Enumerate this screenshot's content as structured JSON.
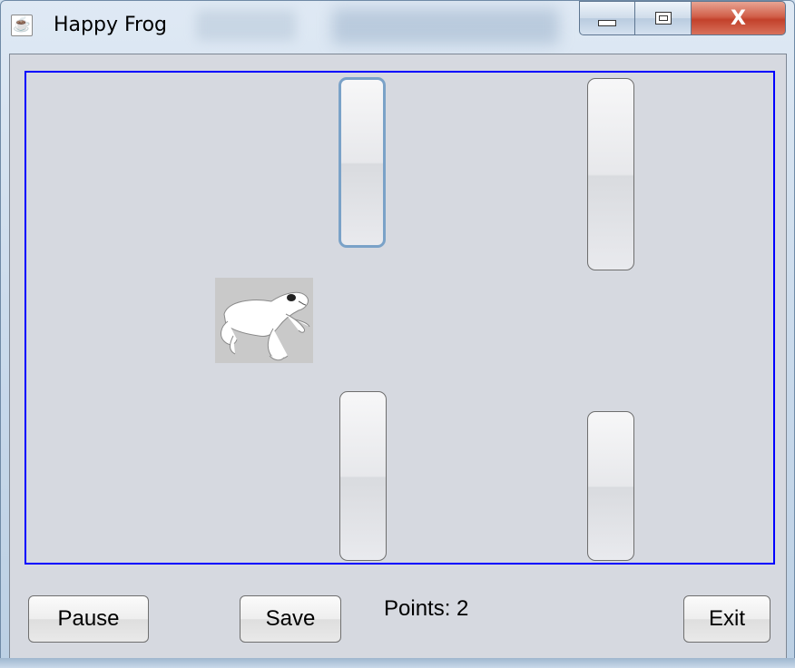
{
  "window": {
    "title": "Happy Frog",
    "app_icon": "java-cup-icon",
    "close_label": "X"
  },
  "game": {
    "points_text": "Points: 2",
    "frog_icon": "frog-icon",
    "border_color": "#0000ff"
  },
  "buttons": {
    "pause": "Pause",
    "save": "Save",
    "exit": "Exit"
  }
}
